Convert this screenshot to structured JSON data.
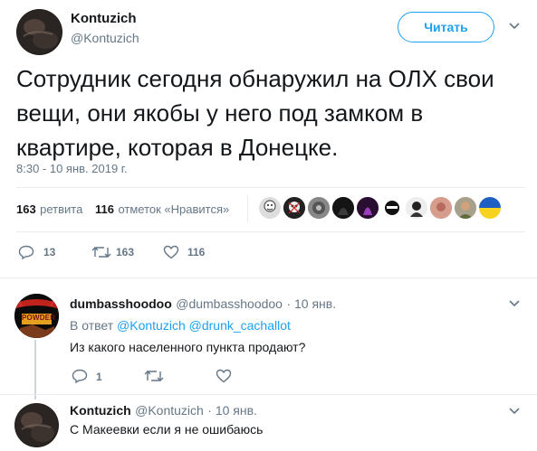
{
  "tweet": {
    "author_name": "Kontuzich",
    "author_handle": "@Kontuzich",
    "follow_label": "Читать",
    "text": "Сотрудник сегодня обнаружил на ОЛХ свои вещи, они якобы у него под замком в квартире, которая в Донецке.",
    "timestamp": "8:30 - 10 янв. 2019 г.",
    "retweets_count": "163",
    "retweets_label": "ретвита",
    "likes_count": "116",
    "likes_label": "отметок «Нравится»",
    "actions": {
      "reply_count": "13",
      "retweet_count": "163",
      "like_count": "116"
    },
    "likers": [
      "avatar-1",
      "avatar-2",
      "avatar-3",
      "avatar-4",
      "avatar-5",
      "avatar-6",
      "avatar-7",
      "avatar-8",
      "avatar-9",
      "avatar-ukraine-flag"
    ]
  },
  "replies": [
    {
      "author_name": "dumbasshoodoo",
      "author_handle": "@dumbasshoodoo",
      "time": "· 10 янв.",
      "avatar_text": "POWDER",
      "reply_to_prefix": "В ответ",
      "reply_to_1": "@Kontuzich",
      "reply_to_2": "@drunk_cachallot",
      "text": "Из какого населенного пункта продают?",
      "reply_count": "1"
    },
    {
      "author_name": "Kontuzich",
      "author_handle": "@Kontuzich",
      "time": "· 10 янв.",
      "text": "С Макеевки если я не ошибаюсь"
    }
  ],
  "colors": {
    "accent": "#1da1f2",
    "muted": "#657786",
    "text": "#14171a",
    "divider": "#e6ecf0"
  }
}
